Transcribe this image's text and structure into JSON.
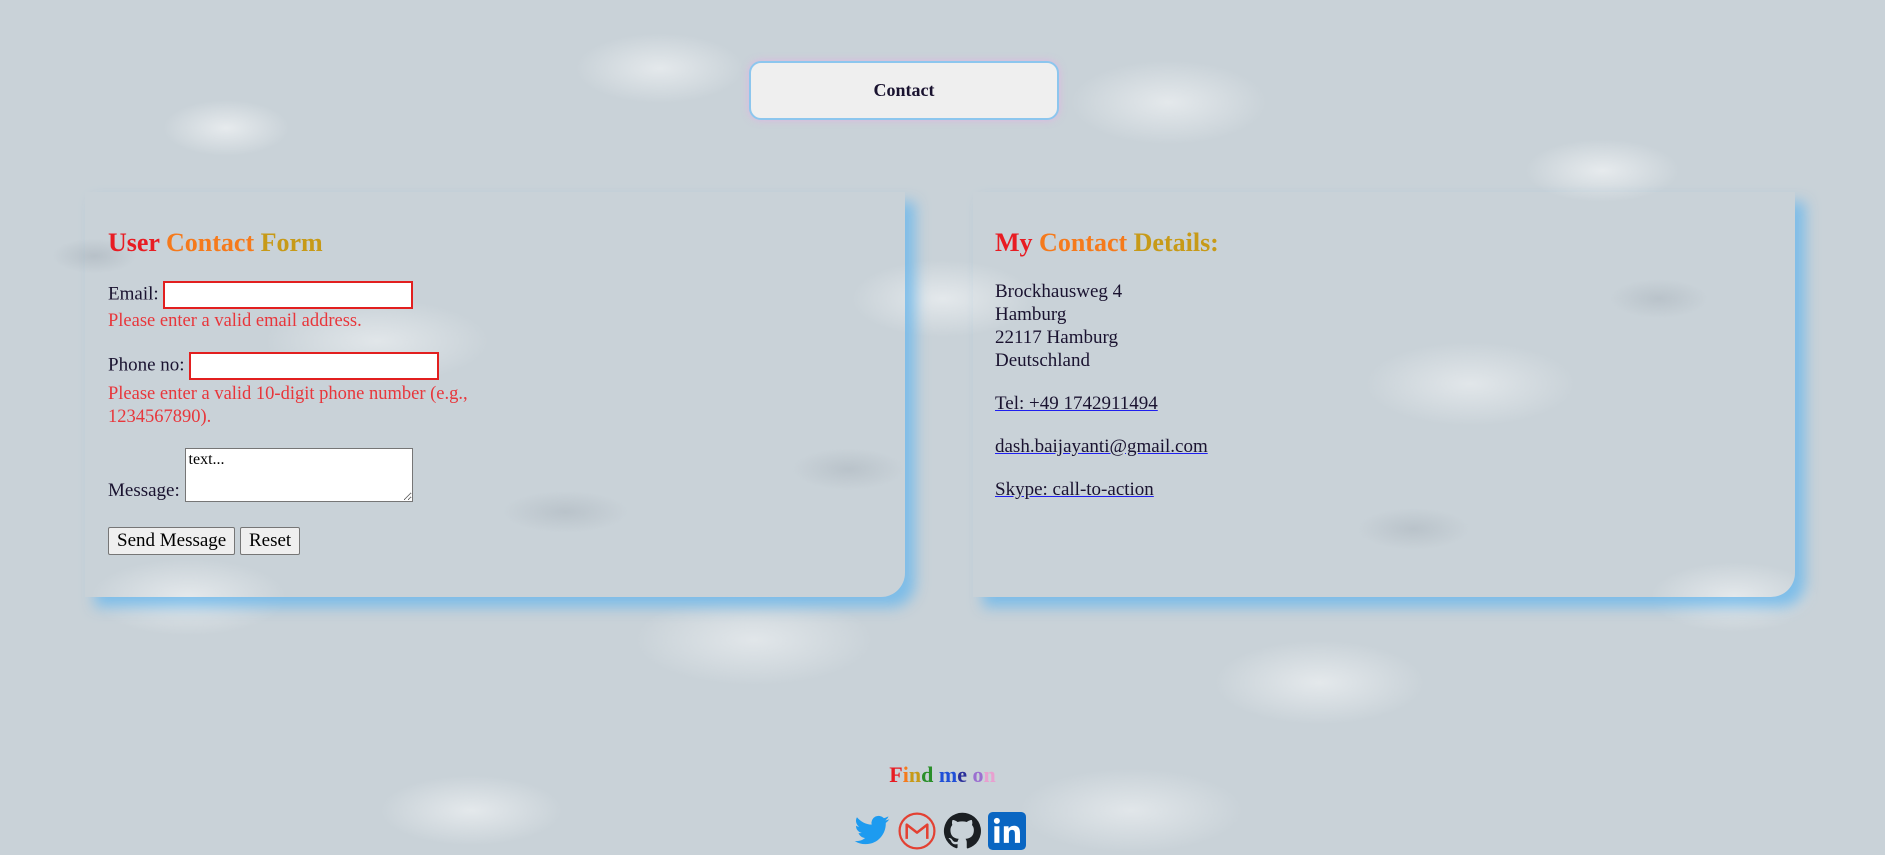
{
  "header": {
    "title": "Contact"
  },
  "form": {
    "title": [
      "User",
      "Contact",
      "Form"
    ],
    "title_colors": [
      "#e81c23",
      "#f57a1c",
      "#c79a18"
    ],
    "email_label": "Email:",
    "email_value": "",
    "email_error": "Please enter a valid email address.",
    "phone_label": "Phone no:",
    "phone_value": "",
    "phone_error_line1": "Please enter a valid 10-digit phone number (e.g.,",
    "phone_error_line2": "1234567890).",
    "message_label": "Message:",
    "message_value": "text...",
    "send_label": "Send Message",
    "reset_label": "Reset"
  },
  "details": {
    "title": [
      "My",
      "Contact",
      "Details:"
    ],
    "address": [
      "Brockhausweg 4",
      "Hamburg",
      "22117 Hamburg",
      "Deutschland"
    ],
    "phone_link": "Tel: +49 1742911494",
    "email_link": "dash.baijayanti@gmail.com",
    "skype_link": "Skype: call-to-action"
  },
  "footer": {
    "find_me_letters": [
      "F",
      "i",
      "n",
      "d",
      " ",
      "m",
      "e",
      " ",
      "o",
      "n"
    ],
    "find_me_colors": [
      "#e81c23",
      "#f57a1c",
      "#c79a18",
      "#2a8f2a",
      "#ffffff",
      "#1f4fd8",
      "#2a2f9a",
      "#ffffff",
      "#9b6fd0",
      "#e8a0d0"
    ],
    "social_icons": [
      "twitter-icon",
      "gmail-icon",
      "github-icon",
      "linkedin-icon"
    ],
    "brand_colors": {
      "twitter": "#1d9bf0",
      "gmail": "#e34133",
      "github": "#1b1f23",
      "linkedin": "#0a66c2"
    }
  }
}
